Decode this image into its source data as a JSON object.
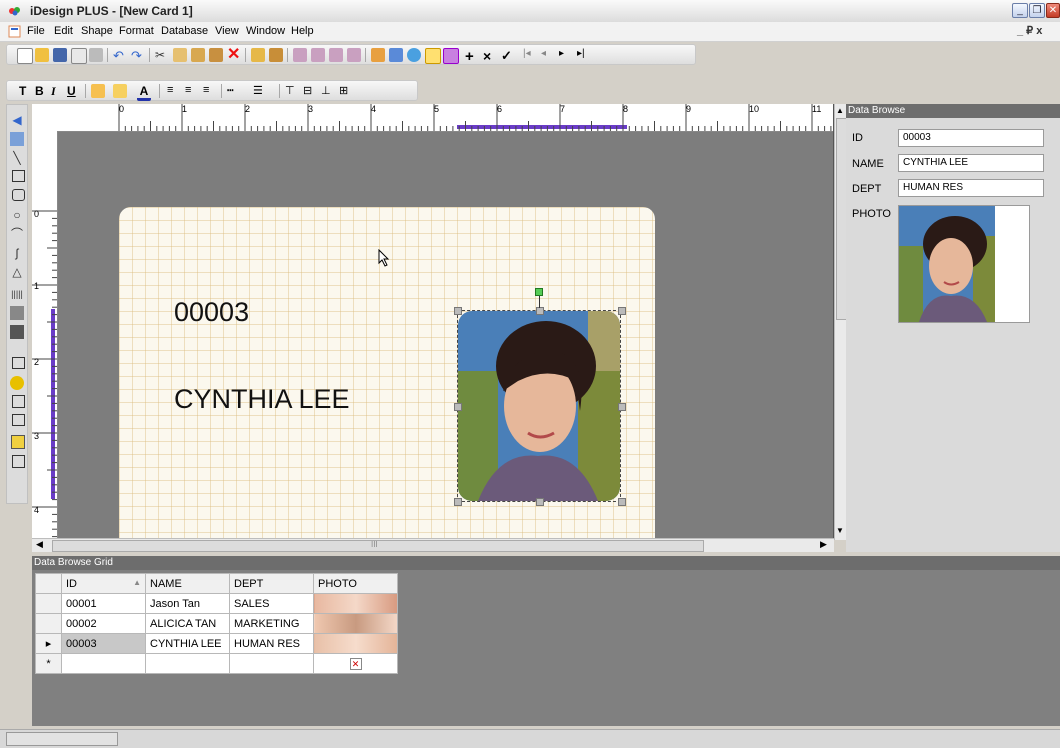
{
  "window": {
    "title": "iDesign PLUS - [New Card 1]"
  },
  "menu": {
    "items": [
      "File",
      "Edit",
      "Shape",
      "Format",
      "Database",
      "View",
      "Window",
      "Help"
    ],
    "mdi_controls": "_ ₽ x"
  },
  "format_toolbar": {
    "text_btn": "T",
    "bold": "B",
    "italic": "I",
    "underline": "U"
  },
  "ruler": {
    "h_labels": [
      "0",
      "1",
      "2",
      "3",
      "4",
      "5",
      "6",
      "7",
      "8",
      "9",
      "10",
      "11"
    ],
    "v_labels": [
      "0",
      "1",
      "2",
      "3",
      "4"
    ]
  },
  "card": {
    "id_text": "00003",
    "name_text": "CYNTHIA LEE"
  },
  "data_browse": {
    "title": "Data Browse",
    "fields": [
      {
        "label": "ID",
        "value": "00003"
      },
      {
        "label": "NAME",
        "value": "CYNTHIA LEE"
      },
      {
        "label": "DEPT",
        "value": "HUMAN RES"
      },
      {
        "label": "PHOTO",
        "value": ""
      }
    ]
  },
  "grid": {
    "title": "Data Browse Grid",
    "columns": [
      "ID",
      "NAME",
      "DEPT",
      "PHOTO"
    ],
    "rows": [
      {
        "id": "00001",
        "name": "Jason Tan",
        "dept": "SALES"
      },
      {
        "id": "00002",
        "name": "ALICICA TAN",
        "dept": "MARKETING"
      },
      {
        "id": "00003",
        "name": "CYNTHIA LEE",
        "dept": "HUMAN RES"
      }
    ],
    "new_row_marker": "*",
    "current_row_marker": "▸"
  },
  "scroll": {
    "h_mark": "III"
  }
}
